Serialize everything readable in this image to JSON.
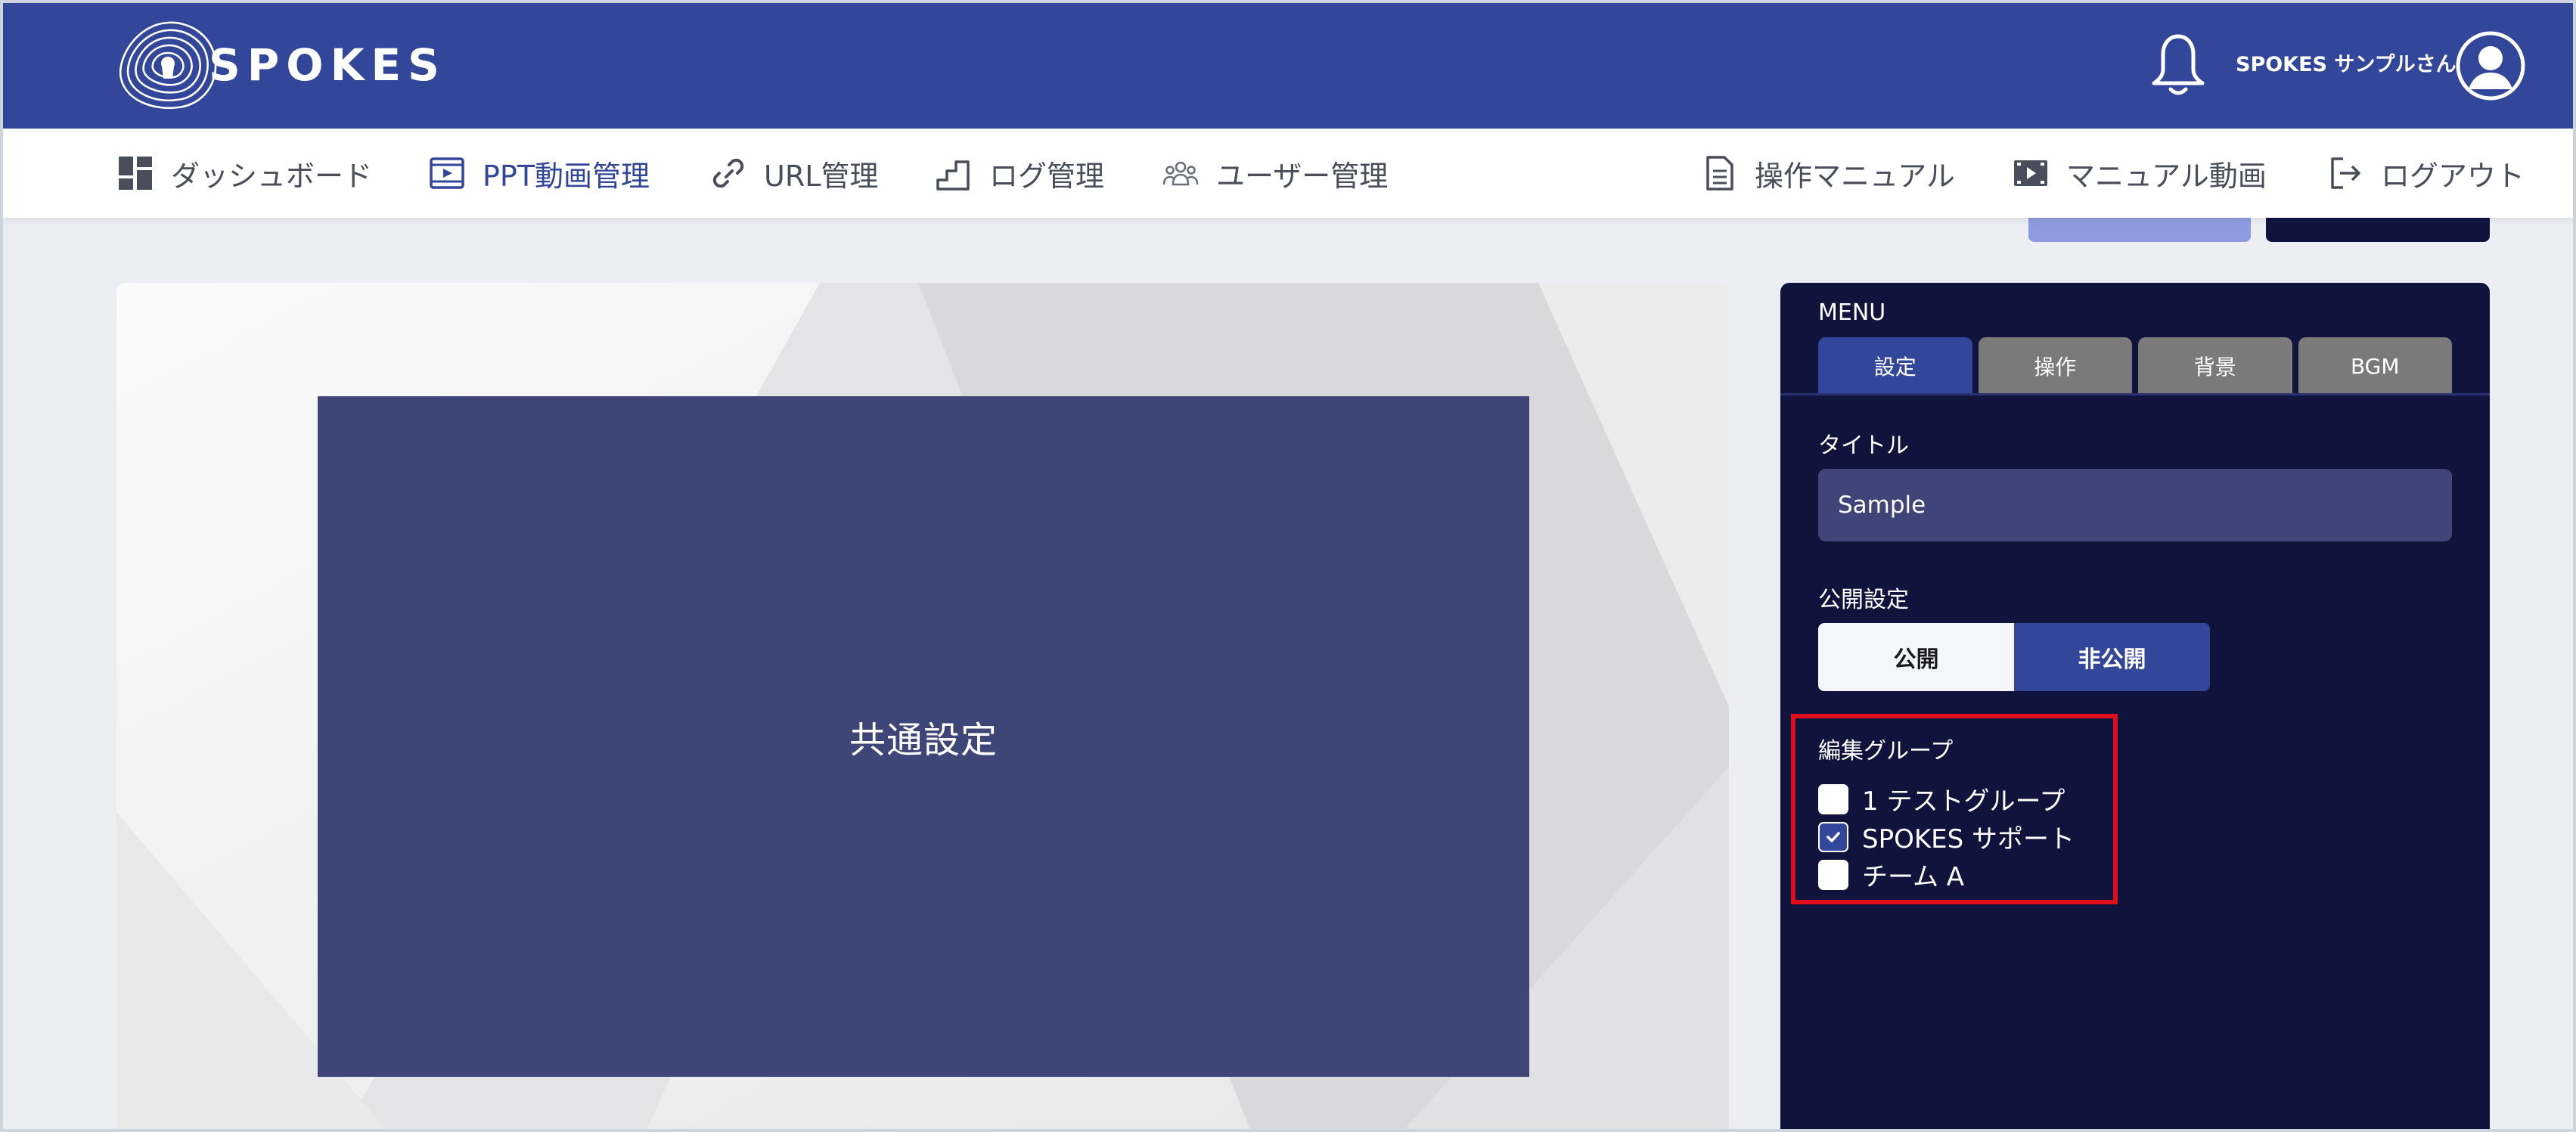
{
  "header": {
    "brand": "SPOKES",
    "user_name": "SPOKES サンプルさん",
    "icons": [
      "spokes-logo-icon",
      "bell-icon",
      "user-avatar-icon"
    ]
  },
  "nav": {
    "left": [
      {
        "label": "ダッシュボード",
        "icon": "dashboard-icon",
        "active": false
      },
      {
        "label": "PPT動画管理",
        "icon": "film-icon",
        "active": true
      },
      {
        "label": "URL管理",
        "icon": "link-icon",
        "active": false
      },
      {
        "label": "ログ管理",
        "icon": "stairs-icon",
        "active": false
      },
      {
        "label": "ユーザー管理",
        "icon": "users-icon",
        "active": false
      }
    ],
    "right": [
      {
        "label": "操作マニュアル",
        "icon": "document-icon"
      },
      {
        "label": "マニュアル動画",
        "icon": "video-icon"
      },
      {
        "label": "ログアウト",
        "icon": "logout-icon"
      }
    ]
  },
  "canvas": {
    "slide_text": "共通設定"
  },
  "menu": {
    "title": "MENU",
    "tabs": [
      "設定",
      "操作",
      "背景",
      "BGM"
    ],
    "active_tab": "設定",
    "title_label": "タイトル",
    "title_value": "Sample",
    "visibility_label": "公開設定",
    "visibility_options": [
      "公開",
      "非公開"
    ],
    "visibility_selected": "非公開",
    "group_label": "編集グループ",
    "groups": [
      {
        "label": "1 テストグループ",
        "checked": false
      },
      {
        "label": "SPOKES サポート",
        "checked": true
      },
      {
        "label": "チーム A",
        "checked": false
      }
    ]
  },
  "colors": {
    "header_bg": "#33479a",
    "panel_bg": "#10143d",
    "slide_bg": "#3e4677",
    "highlight": "#e00d1a",
    "tab_inactive": "#7a7a7a"
  }
}
